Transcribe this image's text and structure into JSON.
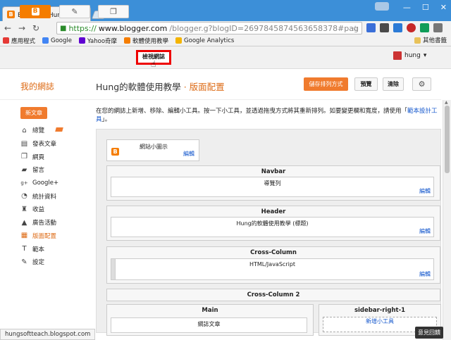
{
  "browser": {
    "tab_title": "Blogger：Hung的軟體使",
    "tab_close": "×",
    "url_scheme": "https://",
    "url_domain": "www.blogger.com",
    "url_path": "/blogger.g?blogID=2697845874563658378#pageelements",
    "controls": {
      "minimize": "—",
      "maximize": "☐",
      "close": "✕"
    },
    "bookmarks": [
      {
        "label": "應用程式",
        "color": "#e53935"
      },
      {
        "label": "Google",
        "color": "#4285f4"
      },
      {
        "label": "Yahoo奇摩",
        "color": "#5f01d1"
      },
      {
        "label": "軟體使用教學",
        "color": "#f57d00"
      },
      {
        "label": "Google Analytics",
        "color": "#f4b400"
      }
    ],
    "other_bookmarks": "其他書籤"
  },
  "blogger": {
    "logo_letter": "B",
    "edit_icon": "✎",
    "pages_icon": "❐",
    "view_blog": "檢視網誌",
    "user_name": "hung",
    "my_blogs": "我的網誌",
    "blog_name": "Hung的軟體使用教學",
    "title_sep": "·",
    "section_name": "版面配置",
    "save_arrangement": "儲存排列方式",
    "preview": "預覽",
    "clear": "清除",
    "new_post": "新文章"
  },
  "sidebar": {
    "items": [
      {
        "label": "總覽",
        "icon": "home-icon",
        "glyph": "⌂"
      },
      {
        "label": "發表文章",
        "icon": "posts-icon",
        "glyph": "▤"
      },
      {
        "label": "網頁",
        "icon": "pages-icon",
        "glyph": "❐"
      },
      {
        "label": "留言",
        "icon": "comments-icon",
        "glyph": "▰"
      },
      {
        "label": "Google+",
        "icon": "gplus-icon",
        "glyph": "g+"
      },
      {
        "label": "統計資料",
        "icon": "stats-icon",
        "glyph": "◔"
      },
      {
        "label": "收益",
        "icon": "earnings-icon",
        "glyph": "♜"
      },
      {
        "label": "廣告活動",
        "icon": "campaigns-icon",
        "glyph": "▲"
      },
      {
        "label": "版面配置",
        "icon": "layout-icon",
        "glyph": "▦"
      },
      {
        "label": "範本",
        "icon": "template-icon",
        "glyph": "T"
      },
      {
        "label": "設定",
        "icon": "settings-icon",
        "glyph": "✎"
      }
    ]
  },
  "main": {
    "description": "在您的網誌上新增、移除、編輯小工具。按一下小工具，並透過拖曳方式將其重新排列。如要變更欄和寬度，請使用「",
    "description_link": "範本設計工具",
    "description_end": "」。",
    "favicon": {
      "title": "網站小圖示",
      "edit": "編輯"
    },
    "sections": [
      {
        "name": "Navbar",
        "widget": "導覽列",
        "edit": "編輯"
      },
      {
        "name": "Header",
        "widget": "Hung的軟體使用教學 (標題)",
        "edit": "編輯"
      },
      {
        "name": "Cross-Column",
        "widget": "HTML/JavaScript",
        "edit": "編輯"
      },
      {
        "name": "Cross-Column 2"
      }
    ],
    "main_col": {
      "name": "Main",
      "widget": "網誌文章"
    },
    "sidebar_col": {
      "name": "sidebar-right-1",
      "add": "新增小工具"
    }
  },
  "status": {
    "url": "hungsoftteach.blogspot.com",
    "feedback": "意見回饋"
  }
}
